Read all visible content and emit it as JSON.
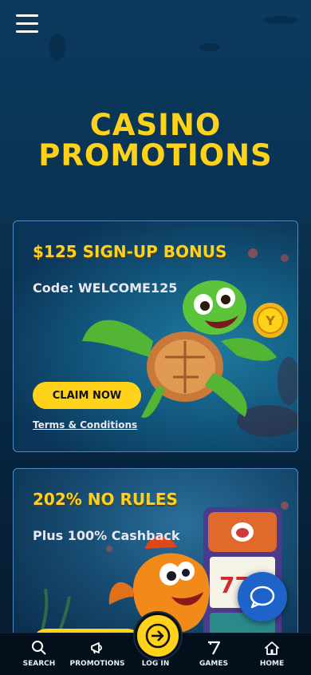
{
  "header": {
    "menu_icon": "hamburger-menu-icon"
  },
  "page": {
    "title_line1": "CASINO",
    "title_line2": "PROMOTIONS"
  },
  "promotions": [
    {
      "title": "$125 SIGN-UP BONUS",
      "subtitle": "Code: WELCOME125",
      "cta": "CLAIM NOW",
      "terms": "Terms & Conditions"
    },
    {
      "title": "202% NO RULES",
      "subtitle": "Plus 100% Cashback"
    }
  ],
  "chat": {
    "icon": "chat-bubble-icon"
  },
  "bottom_nav": [
    {
      "label": "SEARCH",
      "icon": "search-icon"
    },
    {
      "label": "PROMOTIONS",
      "icon": "megaphone-icon"
    },
    {
      "label": "LOG IN",
      "icon": "login-arrow-icon"
    },
    {
      "label": "GAMES",
      "icon": "seven-icon"
    },
    {
      "label": "HOME",
      "icon": "home-icon"
    }
  ],
  "colors": {
    "accent": "#ffd21a",
    "background": "#0a3150",
    "nav": "#03101c",
    "chat": "#1e63c9"
  }
}
